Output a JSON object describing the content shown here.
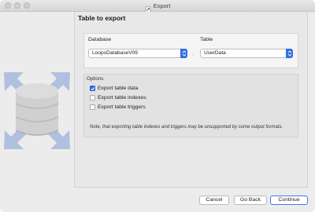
{
  "window": {
    "title": "Export"
  },
  "page": {
    "heading": "Table to export"
  },
  "source": {
    "database_label": "Database",
    "database_value": "LoopsDatabaseV09",
    "separator": ".",
    "table_label": "Table",
    "table_value": "UserData"
  },
  "options": {
    "heading": "Options",
    "items": [
      {
        "label": "Export table data",
        "checked": true
      },
      {
        "label": "Export table indexes",
        "checked": false
      },
      {
        "label": "Export table triggers",
        "checked": false
      }
    ],
    "note": "Note, that exporting table indexes and triggers may be unsupported by some output formats."
  },
  "buttons": {
    "cancel": "Cancel",
    "back": "Go Back",
    "continue": "Continue"
  },
  "colors": {
    "accent": "#2f6fe3",
    "panel": "#e8e8e8",
    "art": "#9fb2d8"
  },
  "icons": [
    "app-icon",
    "database-export-icon",
    "chevron-updown-icon",
    "checkmark-icon"
  ]
}
